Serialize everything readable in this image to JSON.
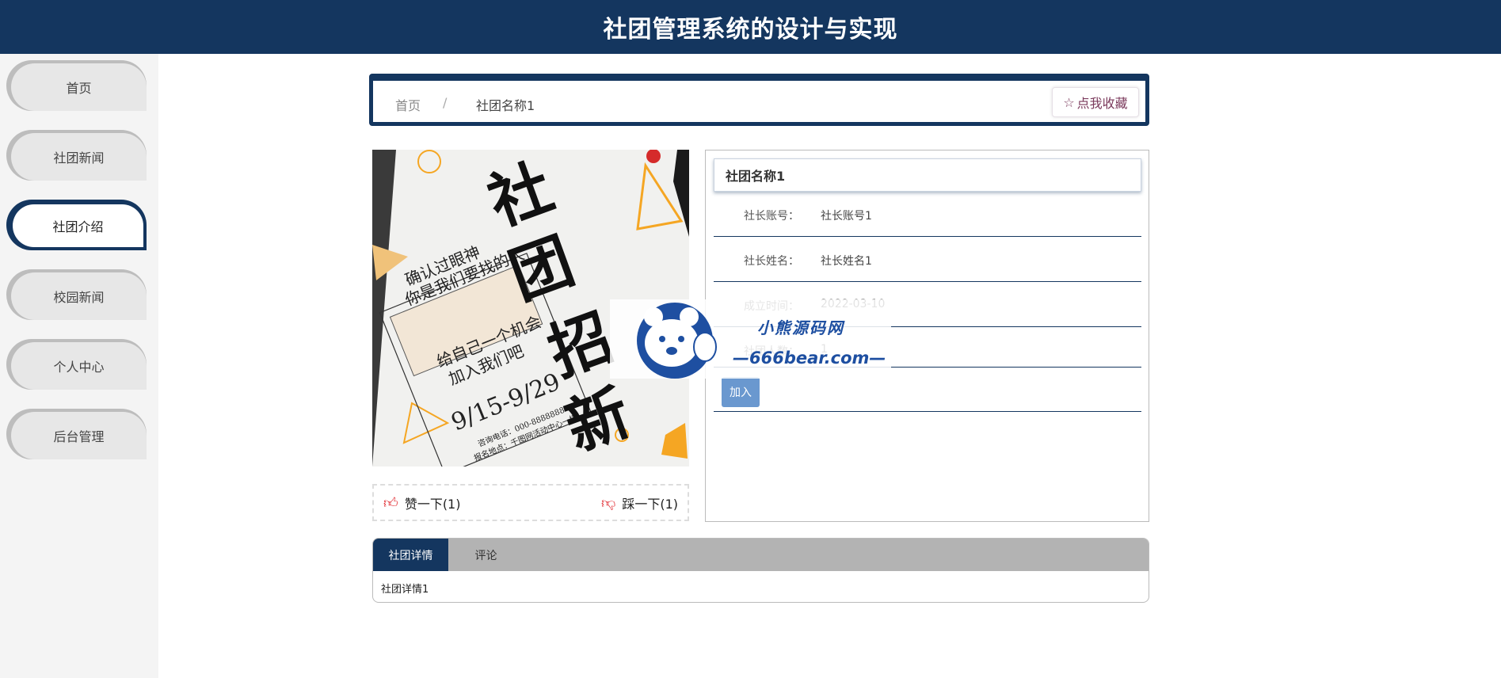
{
  "header": {
    "title": "社团管理系统的设计与实现"
  },
  "sidebar": {
    "items": [
      {
        "label": "首页"
      },
      {
        "label": "社团新闻"
      },
      {
        "label": "社团介绍"
      },
      {
        "label": "校园新闻"
      },
      {
        "label": "个人中心"
      },
      {
        "label": "后台管理"
      }
    ],
    "active_index": 2
  },
  "breadcrumb": {
    "home": "首页",
    "separator": "/",
    "current": "社团名称1",
    "fav_label": "点我收藏"
  },
  "poster": {
    "line1": "确认过眼神",
    "line2": "你是我们要找的人",
    "line3": "给自己一个机会",
    "line4": "加入我们吧",
    "dates": "9/15-9/29",
    "phone": "咨询电话：000-8888888",
    "address": "报名地点：千图网活动中心一楼",
    "big_chars": [
      "社",
      "团",
      "招",
      "新"
    ]
  },
  "votes": {
    "like": "赞一下(1)",
    "dislike": "踩一下(1)"
  },
  "club": {
    "name": "社团名称1",
    "fields": [
      {
        "key": "社长账号：",
        "value": "社长账号1"
      },
      {
        "key": "社长姓名：",
        "value": "社长姓名1"
      },
      {
        "key": "成立时间：",
        "value": "2022-03-10"
      },
      {
        "key": "社团人数：",
        "value": "1"
      }
    ],
    "join_label": "加入"
  },
  "tabs": {
    "items": [
      {
        "label": "社团详情"
      },
      {
        "label": "评论"
      }
    ],
    "content": "社团详情1"
  },
  "watermark": {
    "name": "小熊源码网",
    "site": "—666bear.com—"
  },
  "colors": {
    "primary": "#14365f",
    "join": "#6a98cf",
    "accent": "#f5a623"
  },
  "icons": {
    "star": "star-icon",
    "like": "thumbs-up-icon",
    "dislike": "thumbs-down-icon",
    "bear": "bear-logo-icon"
  }
}
